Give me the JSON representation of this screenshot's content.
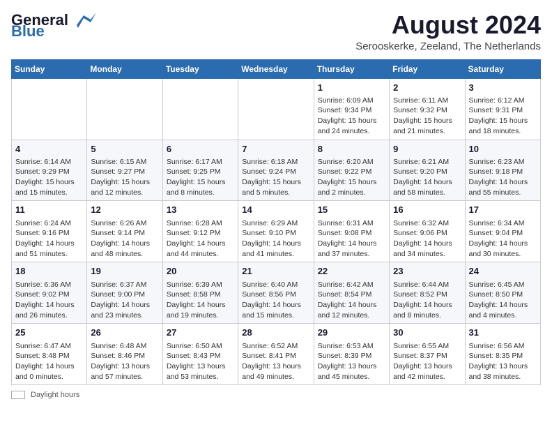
{
  "header": {
    "logo_general": "General",
    "logo_blue": "Blue",
    "month_year": "August 2024",
    "location": "Serooskerke, Zeeland, The Netherlands"
  },
  "days_of_week": [
    "Sunday",
    "Monday",
    "Tuesday",
    "Wednesday",
    "Thursday",
    "Friday",
    "Saturday"
  ],
  "weeks": [
    [
      {
        "day": "",
        "info": ""
      },
      {
        "day": "",
        "info": ""
      },
      {
        "day": "",
        "info": ""
      },
      {
        "day": "",
        "info": ""
      },
      {
        "day": "1",
        "info": "Sunrise: 6:09 AM\nSunset: 9:34 PM\nDaylight: 15 hours and 24 minutes."
      },
      {
        "day": "2",
        "info": "Sunrise: 6:11 AM\nSunset: 9:32 PM\nDaylight: 15 hours and 21 minutes."
      },
      {
        "day": "3",
        "info": "Sunrise: 6:12 AM\nSunset: 9:31 PM\nDaylight: 15 hours and 18 minutes."
      }
    ],
    [
      {
        "day": "4",
        "info": "Sunrise: 6:14 AM\nSunset: 9:29 PM\nDaylight: 15 hours and 15 minutes."
      },
      {
        "day": "5",
        "info": "Sunrise: 6:15 AM\nSunset: 9:27 PM\nDaylight: 15 hours and 12 minutes."
      },
      {
        "day": "6",
        "info": "Sunrise: 6:17 AM\nSunset: 9:25 PM\nDaylight: 15 hours and 8 minutes."
      },
      {
        "day": "7",
        "info": "Sunrise: 6:18 AM\nSunset: 9:24 PM\nDaylight: 15 hours and 5 minutes."
      },
      {
        "day": "8",
        "info": "Sunrise: 6:20 AM\nSunset: 9:22 PM\nDaylight: 15 hours and 2 minutes."
      },
      {
        "day": "9",
        "info": "Sunrise: 6:21 AM\nSunset: 9:20 PM\nDaylight: 14 hours and 58 minutes."
      },
      {
        "day": "10",
        "info": "Sunrise: 6:23 AM\nSunset: 9:18 PM\nDaylight: 14 hours and 55 minutes."
      }
    ],
    [
      {
        "day": "11",
        "info": "Sunrise: 6:24 AM\nSunset: 9:16 PM\nDaylight: 14 hours and 51 minutes."
      },
      {
        "day": "12",
        "info": "Sunrise: 6:26 AM\nSunset: 9:14 PM\nDaylight: 14 hours and 48 minutes."
      },
      {
        "day": "13",
        "info": "Sunrise: 6:28 AM\nSunset: 9:12 PM\nDaylight: 14 hours and 44 minutes."
      },
      {
        "day": "14",
        "info": "Sunrise: 6:29 AM\nSunset: 9:10 PM\nDaylight: 14 hours and 41 minutes."
      },
      {
        "day": "15",
        "info": "Sunrise: 6:31 AM\nSunset: 9:08 PM\nDaylight: 14 hours and 37 minutes."
      },
      {
        "day": "16",
        "info": "Sunrise: 6:32 AM\nSunset: 9:06 PM\nDaylight: 14 hours and 34 minutes."
      },
      {
        "day": "17",
        "info": "Sunrise: 6:34 AM\nSunset: 9:04 PM\nDaylight: 14 hours and 30 minutes."
      }
    ],
    [
      {
        "day": "18",
        "info": "Sunrise: 6:36 AM\nSunset: 9:02 PM\nDaylight: 14 hours and 26 minutes."
      },
      {
        "day": "19",
        "info": "Sunrise: 6:37 AM\nSunset: 9:00 PM\nDaylight: 14 hours and 23 minutes."
      },
      {
        "day": "20",
        "info": "Sunrise: 6:39 AM\nSunset: 8:58 PM\nDaylight: 14 hours and 19 minutes."
      },
      {
        "day": "21",
        "info": "Sunrise: 6:40 AM\nSunset: 8:56 PM\nDaylight: 14 hours and 15 minutes."
      },
      {
        "day": "22",
        "info": "Sunrise: 6:42 AM\nSunset: 8:54 PM\nDaylight: 14 hours and 12 minutes."
      },
      {
        "day": "23",
        "info": "Sunrise: 6:44 AM\nSunset: 8:52 PM\nDaylight: 14 hours and 8 minutes."
      },
      {
        "day": "24",
        "info": "Sunrise: 6:45 AM\nSunset: 8:50 PM\nDaylight: 14 hours and 4 minutes."
      }
    ],
    [
      {
        "day": "25",
        "info": "Sunrise: 6:47 AM\nSunset: 8:48 PM\nDaylight: 14 hours and 0 minutes."
      },
      {
        "day": "26",
        "info": "Sunrise: 6:48 AM\nSunset: 8:46 PM\nDaylight: 13 hours and 57 minutes."
      },
      {
        "day": "27",
        "info": "Sunrise: 6:50 AM\nSunset: 8:43 PM\nDaylight: 13 hours and 53 minutes."
      },
      {
        "day": "28",
        "info": "Sunrise: 6:52 AM\nSunset: 8:41 PM\nDaylight: 13 hours and 49 minutes."
      },
      {
        "day": "29",
        "info": "Sunrise: 6:53 AM\nSunset: 8:39 PM\nDaylight: 13 hours and 45 minutes."
      },
      {
        "day": "30",
        "info": "Sunrise: 6:55 AM\nSunset: 8:37 PM\nDaylight: 13 hours and 42 minutes."
      },
      {
        "day": "31",
        "info": "Sunrise: 6:56 AM\nSunset: 8:35 PM\nDaylight: 13 hours and 38 minutes."
      }
    ]
  ],
  "footer": {
    "swatch_label": "Daylight hours"
  }
}
